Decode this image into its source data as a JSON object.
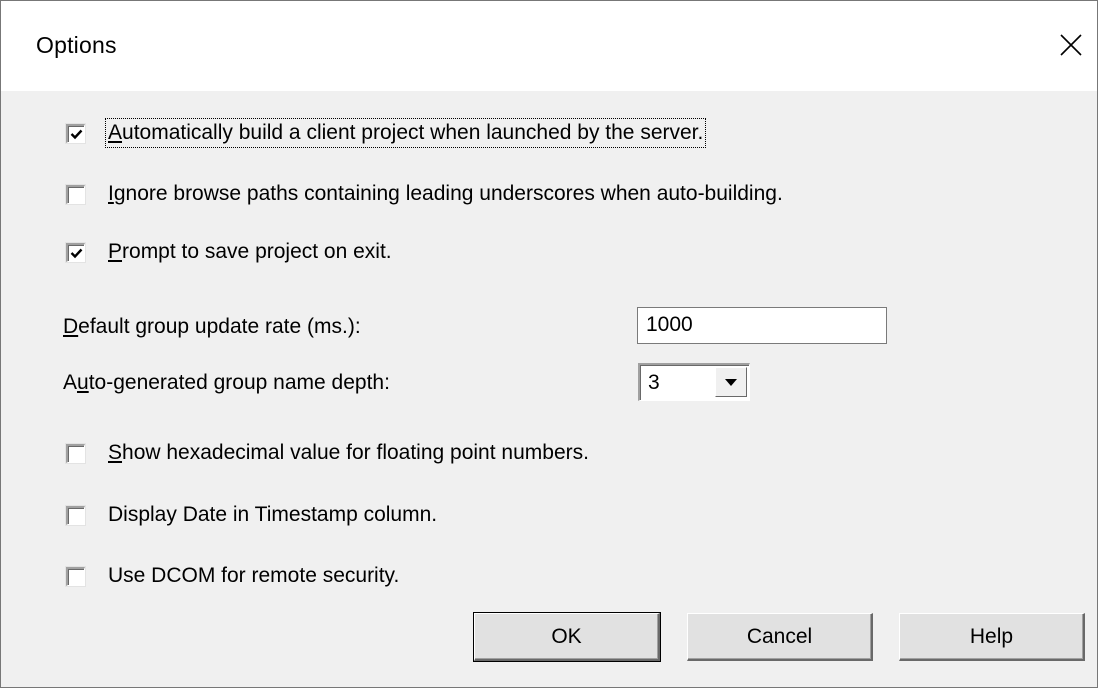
{
  "window": {
    "title": "Options"
  },
  "checkboxes": {
    "auto_build": {
      "pre": "",
      "mnemonic": "A",
      "post": "utomatically build a client project when launched by the server.",
      "checked": true
    },
    "ignore_browse": {
      "pre": "",
      "mnemonic": "I",
      "post": "gnore browse paths containing leading underscores when auto-building.",
      "checked": false
    },
    "prompt_save": {
      "pre": "",
      "mnemonic": "P",
      "post": "rompt to save project on exit.",
      "checked": true
    },
    "show_hex": {
      "pre": "",
      "mnemonic": "S",
      "post": "how hexadecimal value for floating point numbers.",
      "checked": false
    },
    "display_date": {
      "pre": "Display Date in Timestamp column.",
      "mnemonic": "",
      "post": "",
      "checked": false
    },
    "use_dcom": {
      "pre": "Use DCOM for remote security.",
      "mnemonic": "",
      "post": "",
      "checked": false
    }
  },
  "fields": {
    "update_rate": {
      "label_pre": "",
      "label_mnemonic": "D",
      "label_post": "efault group update rate (ms.):",
      "value": "1000"
    },
    "name_depth": {
      "label_pre": "A",
      "label_mnemonic": "u",
      "label_post": "to-generated group name depth:",
      "value": "3"
    }
  },
  "buttons": {
    "ok": "OK",
    "cancel": "Cancel",
    "help": "Help"
  },
  "icons": {
    "close": "close-icon",
    "check": "check-icon",
    "dropdown": "chevron-down-icon"
  }
}
